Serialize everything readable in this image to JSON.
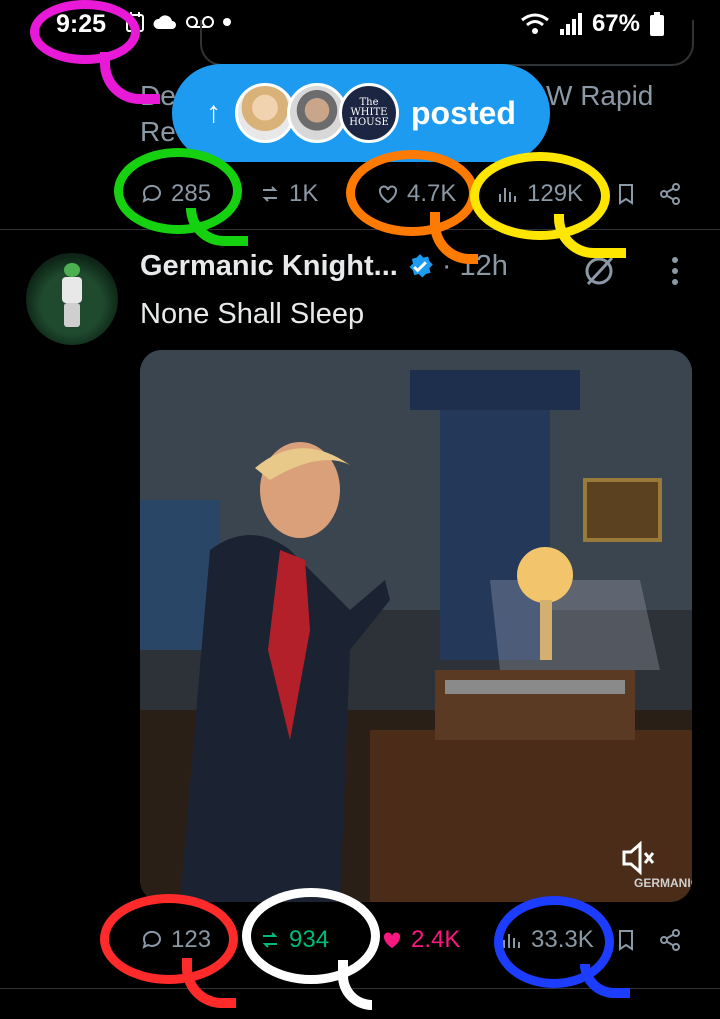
{
  "status_bar": {
    "time": "9:25",
    "battery": "67%"
  },
  "previous_tweet": {
    "text_left": "De",
    "text_right": "W Rapid",
    "text_line2": "Re"
  },
  "posted_banner": {
    "arrow": "↑",
    "label": "posted",
    "avatar3_text": "The WHITE HOUSE"
  },
  "prev_actions": {
    "replies": "285",
    "reposts": "1K",
    "likes": "4.7K",
    "views": "129K"
  },
  "tweet": {
    "author": "Germanic Knight...",
    "separator": "·",
    "time": "12h",
    "text": "None Shall Sleep",
    "media_watermark": "GERMANIC",
    "actions": {
      "replies": "123",
      "reposts": "934",
      "likes": "2.4K",
      "views": "33.3K"
    }
  },
  "colors": {
    "background": "#000000",
    "accent": "#1d9bf0",
    "muted_text": "#8b98a5",
    "repost_active": "#00ba7c",
    "like_active": "#f91880",
    "annotation_magenta": "#e81ad8",
    "annotation_green": "#16d10f",
    "annotation_orange": "#ff7a00",
    "annotation_yellow": "#ffe600",
    "annotation_red": "#ff2a2a",
    "annotation_white": "#ffffff",
    "annotation_blue": "#1c3cff"
  },
  "icons": [
    "reply-icon",
    "repost-icon",
    "like-icon",
    "views-icon",
    "bookmark-icon",
    "share-icon",
    "grok-icon",
    "more-icon",
    "verified-icon",
    "mute-icon",
    "wifi-icon",
    "signal-icon",
    "battery-icon"
  ]
}
